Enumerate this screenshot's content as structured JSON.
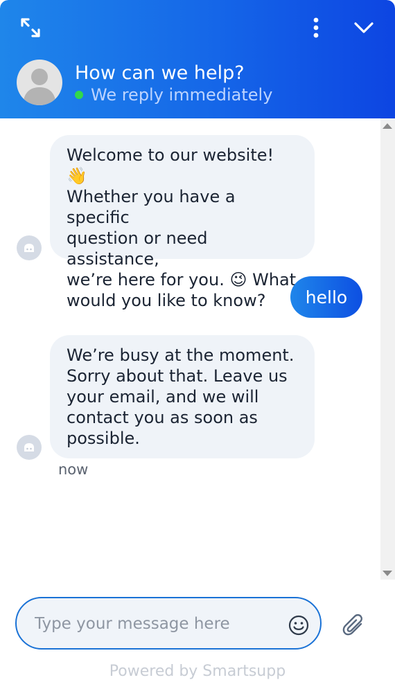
{
  "header": {
    "title": "How can we help?",
    "status_text": "We reply immediately",
    "icons": [
      "expand-icon",
      "more-vertical-icon",
      "chevron-down-icon",
      "user-avatar"
    ]
  },
  "messages": [
    {
      "from": "bot",
      "lines": [
        "Welcome to our website! 👋",
        "Whether you have a specific",
        "question or need assistance,",
        "we’re here for you. 😉 What",
        "would you like to know?"
      ]
    },
    {
      "from": "user",
      "text": "hello"
    },
    {
      "from": "bot",
      "lines": [
        "We’re busy at the moment.",
        "Sorry about that. Leave us",
        "your email, and we will",
        "contact you as soon as",
        "possible."
      ],
      "time": "now"
    }
  ],
  "composer": {
    "placeholder": "Type your message here",
    "value": ""
  },
  "footer": {
    "powered_by": "Powered by Smartsupp"
  },
  "colors": {
    "header_start": "#1f86ea",
    "header_end": "#0d45e2",
    "bubble_in": "#eff3f8",
    "online": "#32d84a",
    "composer_border": "#1a72d6"
  }
}
